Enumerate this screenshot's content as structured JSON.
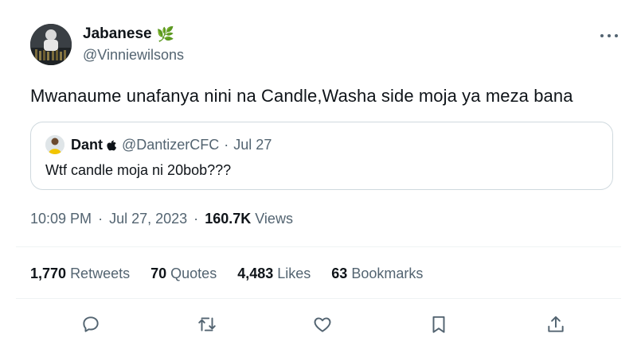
{
  "author": {
    "display_name": "Jabanese",
    "badge_emoji": "🌿",
    "handle": "@Vinniewilsons"
  },
  "tweet": {
    "text": "Mwanaume unafanya nini na Candle,Washa side moja ya meza bana"
  },
  "quoted": {
    "display_name": "Dant",
    "handle": "@DantizerCFC",
    "separator": "·",
    "date": "Jul 27",
    "text": "Wtf candle moja ni 20bob???"
  },
  "meta": {
    "time": "10:09 PM",
    "separator": "·",
    "date": "Jul 27, 2023",
    "views_count": "160.7K",
    "views_label": "Views"
  },
  "stats": [
    {
      "count": "1,770",
      "label": "Retweets"
    },
    {
      "count": "70",
      "label": "Quotes"
    },
    {
      "count": "4,483",
      "label": "Likes"
    },
    {
      "count": "63",
      "label": "Bookmarks"
    }
  ],
  "icons": {
    "more": "more-horizontal-icon",
    "reply": "reply-icon",
    "retweet": "retweet-icon",
    "like": "heart-icon",
    "bookmark": "bookmark-icon",
    "share": "share-icon"
  },
  "colors": {
    "text": "#0f1419",
    "muted": "#536471",
    "border": "#cfd9de"
  }
}
